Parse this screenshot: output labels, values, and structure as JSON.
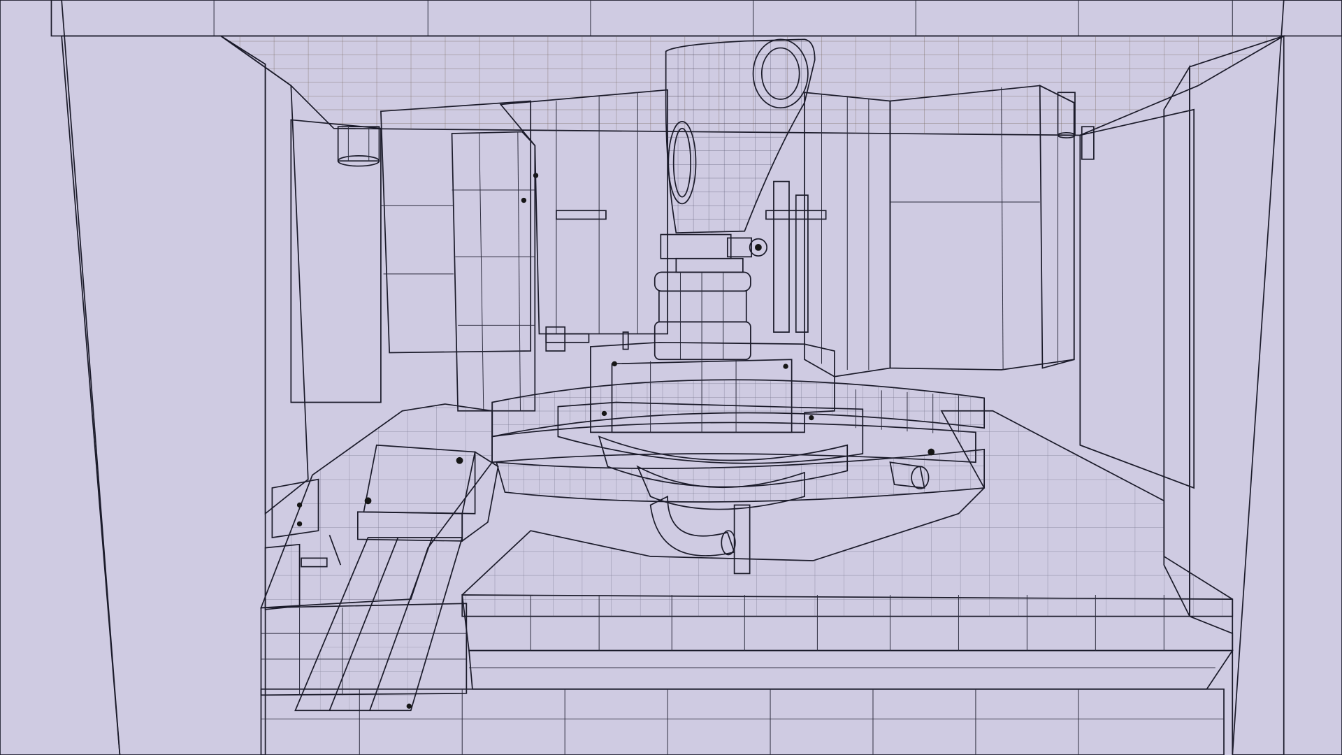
{
  "scene": {
    "kind": "3d-viewport-wireframe-render",
    "subject": "pharmaceutical-rotary-tablet-press-model",
    "colors": {
      "surface": "#f2f2ff",
      "surface_shade": "#dcdcf6",
      "wall_left": "#a8a4c8",
      "wall_right": "#b9a6ac",
      "ceiling": "#b49a84",
      "edge": "#1b1b2a",
      "hole": "#161616"
    },
    "visible_text": []
  }
}
